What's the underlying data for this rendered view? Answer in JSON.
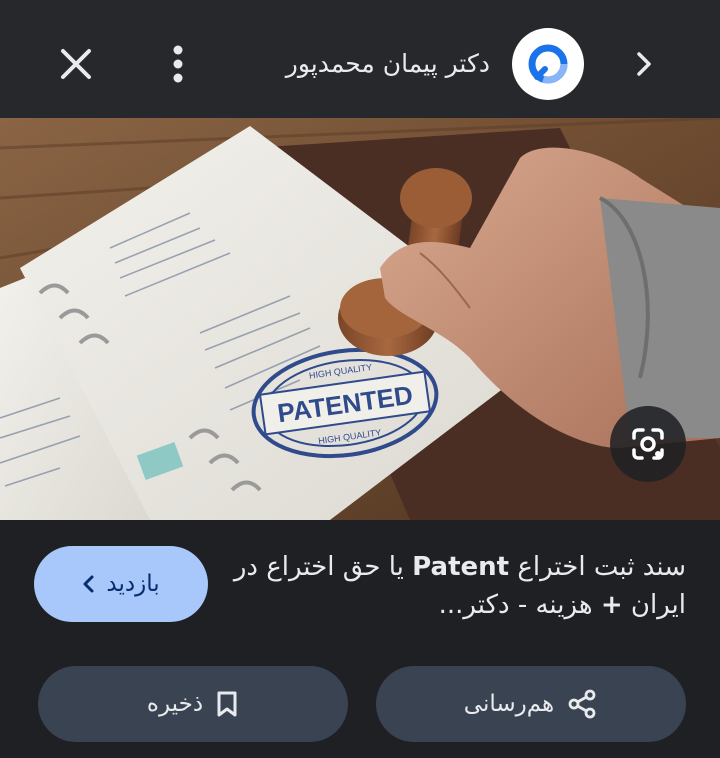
{
  "header": {
    "site_name": "دکتر پیمان محمدپور",
    "close_icon": "close-icon",
    "more_icon": "more-vert-icon",
    "next_icon": "chevron-right-icon"
  },
  "image": {
    "stamp_top": "HIGH QUALITY",
    "stamp_main": "PATENTED",
    "stamp_bottom": "HIGH QUALITY",
    "lens_icon": "google-lens-icon"
  },
  "result": {
    "title_part1": "سند ثبت اختراع ",
    "title_bold1": "Patent",
    "title_part2": " یا حق اختراع در ایران ",
    "title_bold2": "+",
    "title_part3": " هزینه - دکتر..."
  },
  "actions": {
    "visit_label": "بازدید",
    "save_label": "ذخیره",
    "share_label": "هم‌رسانی"
  },
  "colors": {
    "background": "#1f2024",
    "topbar": "#26282c",
    "visit_button": "#a8c7fa",
    "pill_button": "#3a4352"
  }
}
